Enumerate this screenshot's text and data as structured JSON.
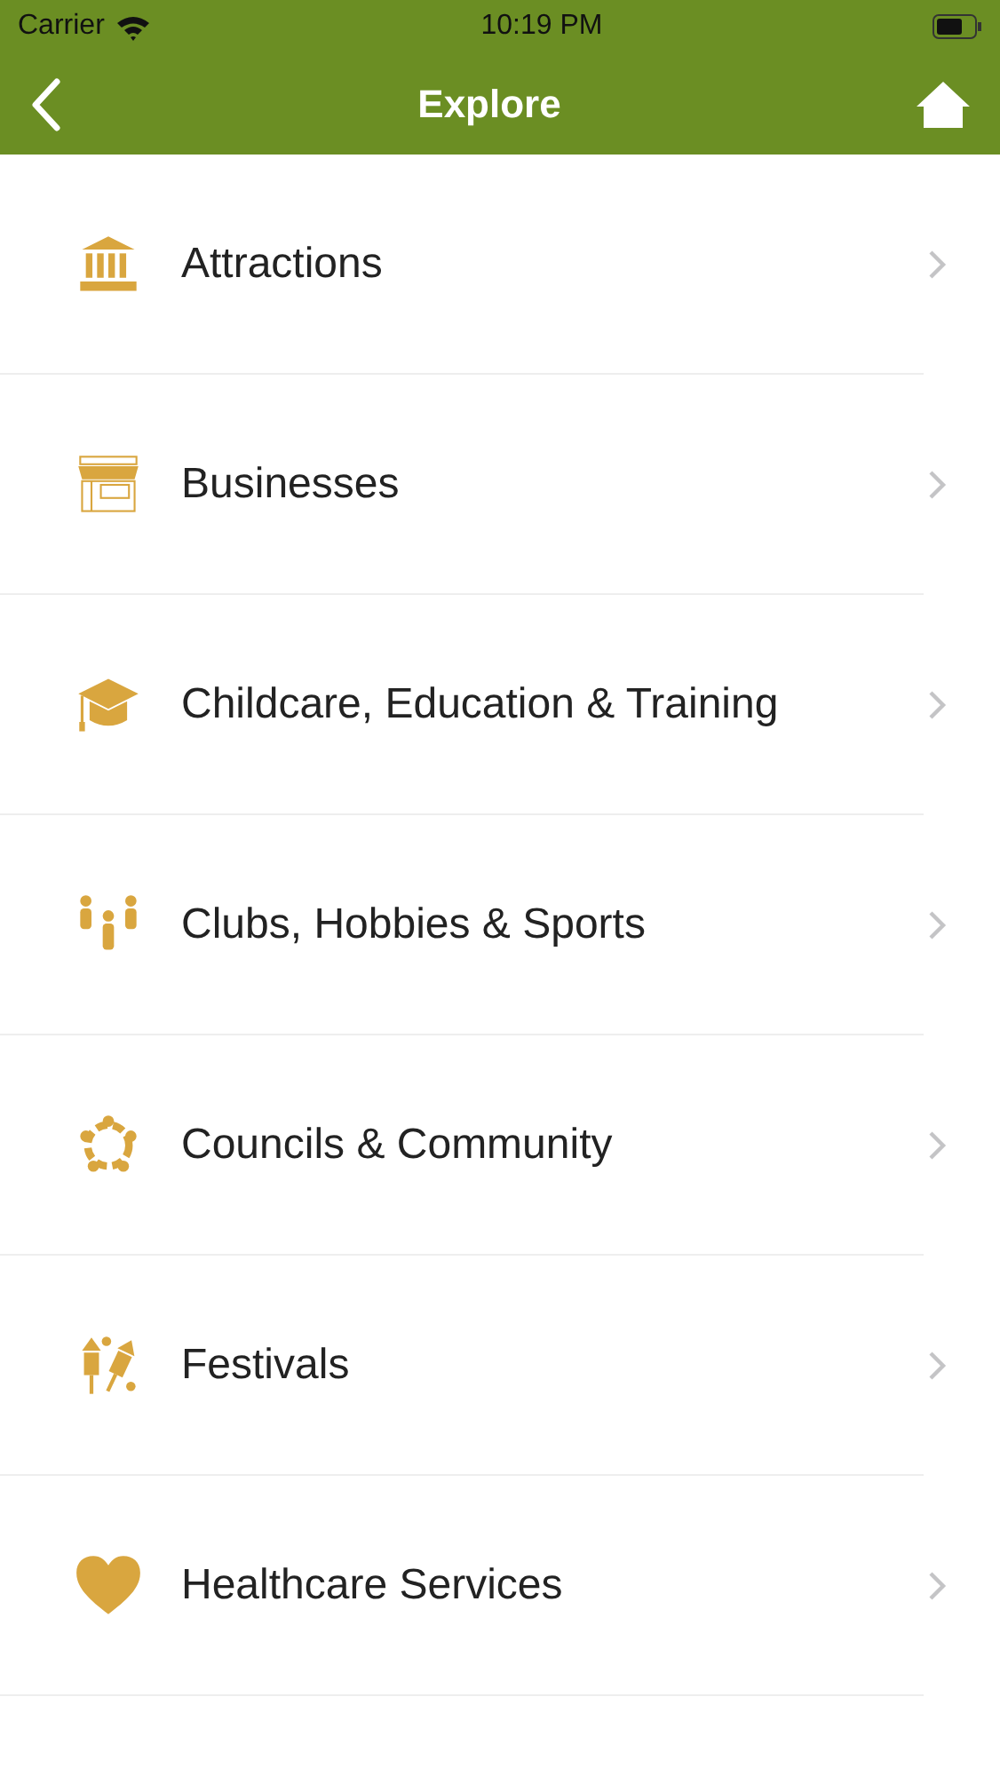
{
  "status_bar": {
    "carrier": "Carrier",
    "time": "10:19 PM"
  },
  "nav_bar": {
    "title": "Explore"
  },
  "items": [
    {
      "label": "Attractions",
      "kind": "building"
    },
    {
      "label": "Businesses",
      "kind": "shop"
    },
    {
      "label": "Childcare, Education & Training",
      "kind": "cap"
    },
    {
      "label": "Clubs, Hobbies & Sports",
      "kind": "people"
    },
    {
      "label": "Councils & Community",
      "kind": "circle"
    },
    {
      "label": "Festivals",
      "kind": "rockets"
    },
    {
      "label": "Healthcare Services",
      "kind": "heart"
    }
  ]
}
